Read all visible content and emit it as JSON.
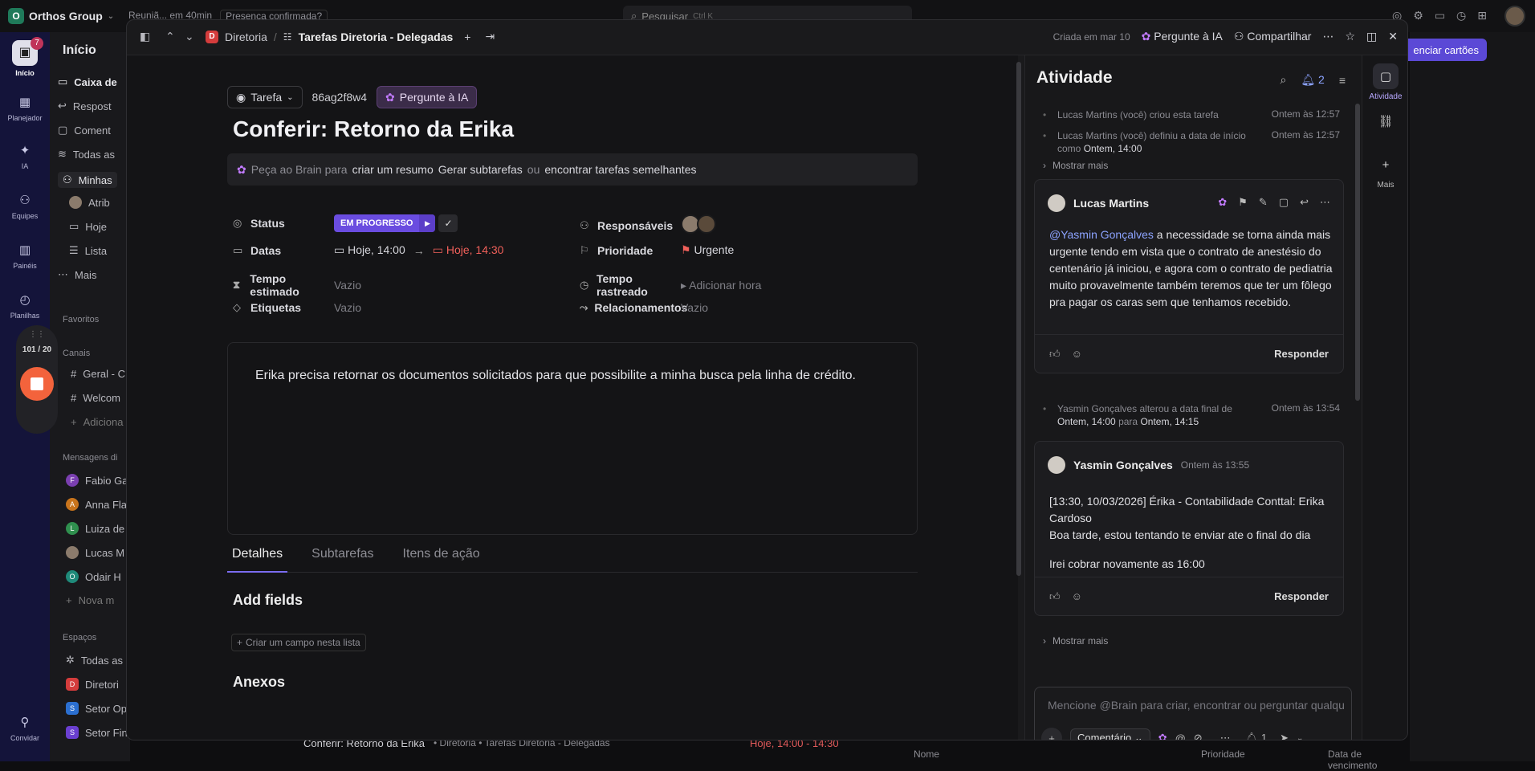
{
  "topbar": {
    "workspace": "Orthos Group",
    "workspace_initial": "O",
    "meeting_text": "Reuniã... em 40min",
    "meeting_status": "Presença confirmada?",
    "search_placeholder": "Pesquisar",
    "search_shortcut": "Ctrl K"
  },
  "rail": {
    "items": [
      {
        "label": "Início",
        "icon": "inbox-icon"
      },
      {
        "label": "Planejador",
        "icon": "calendar-icon"
      },
      {
        "label": "IA",
        "icon": "ai-icon"
      },
      {
        "label": "Equipes",
        "icon": "teams-icon"
      },
      {
        "label": "Painéis",
        "icon": "dashboard-icon"
      },
      {
        "label": "Planilhas",
        "icon": "timesheet-icon"
      },
      {
        "label": "Convidar",
        "icon": "invite-icon"
      }
    ],
    "badge": "7"
  },
  "recording": {
    "counter": "101 / 20"
  },
  "sidebar": {
    "title": "Início",
    "items": [
      "Caixa de",
      "Respost",
      "Coment",
      "Todas as",
      "Minhas",
      "Atrib",
      "Hoje",
      "Lista",
      "Mais"
    ],
    "favorites_label": "Favoritos",
    "channels_label": "Canais",
    "channels": [
      "Geral - C",
      "Welcom",
      "Adiciona"
    ],
    "dm_label": "Mensagens di",
    "dms": [
      {
        "initial": "F",
        "name": "Fabio Ga",
        "color": "#7a3fb0"
      },
      {
        "initial": "A",
        "name": "Anna Fla",
        "color": "#c8741c"
      },
      {
        "initial": "L",
        "name": "Luiza de",
        "color": "#2f8f4e"
      },
      {
        "initial": "",
        "name": "Lucas M",
        "color": "#8b7b6c"
      },
      {
        "initial": "O",
        "name": "Odair H",
        "color": "#1f8a7a"
      }
    ],
    "new_message": "Nova m",
    "spaces_label": "Espaços",
    "spaces": [
      {
        "initial": "",
        "name": "Todas as",
        "color": "#333"
      },
      {
        "initial": "D",
        "name": "Diretori",
        "color": "#d43c3c"
      },
      {
        "initial": "S",
        "name": "Setor Op",
        "color": "#2b6fd0"
      },
      {
        "initial": "S",
        "name": "Setor Fin",
        "color": "#6a3fd0"
      }
    ]
  },
  "background": {
    "button": "enciar cartões",
    "bottom_task": "Conferir: Retorno da Erika",
    "bottom_path": "• Diretoria • Tarefas Diretoria - Delegadas",
    "bottom_date": "Hoje, 14:00 - 14:30",
    "col_name": "Nome",
    "col_priority": "Prioridade",
    "col_due": "Data de vencimento"
  },
  "modal": {
    "breadcrumb_space": "Diretoria",
    "breadcrumb_list": "Tarefas Diretoria - Delegadas",
    "created": "Criada em mar 10",
    "ask_ai": "Pergunte à IA",
    "share": "Compartilhar",
    "task_type": "Tarefa",
    "task_id": "86ag2f8w4",
    "title": "Conferir: Retorno da Erika",
    "brain": {
      "prefix": "Peça ao Brain para",
      "opt1": "criar um resumo",
      "opt2": "Gerar subtarefas",
      "or": "ou",
      "opt3": "encontrar tarefas semelhantes"
    },
    "props": {
      "status_label": "Status",
      "status_value": "EM PROGRESSO",
      "dates_label": "Datas",
      "date_start": "Hoje, 14:00",
      "date_end": "Hoje, 14:30",
      "estimate_label": "Tempo estimado",
      "estimate_value": "Vazio",
      "tags_label": "Etiquetas",
      "tags_value": "Vazio",
      "assignees_label": "Responsáveis",
      "priority_label": "Prioridade",
      "priority_value": "Urgente",
      "tracked_label": "Tempo rastreado",
      "tracked_value": "Adicionar hora",
      "relations_label": "Relacionamentos",
      "relations_value": "Vazio"
    },
    "description": "Erika precisa retornar os documentos solicitados para que possibilite a minha busca pela linha de crédito.",
    "tabs": [
      "Detalhes",
      "Subtarefas",
      "Itens de ação"
    ],
    "add_fields": "Add fields",
    "create_field": "Criar um campo nesta lista",
    "attachments": "Anexos"
  },
  "activity": {
    "title": "Atividade",
    "notif_count": "2",
    "events": [
      {
        "text": "Lucas Martins (você) criou esta tarefa",
        "time": "Ontem às 12:57"
      },
      {
        "text": "Lucas Martins (você) definiu a data de início como",
        "bold": "Ontem, 14:00",
        "time": "Ontem às 12:57"
      }
    ],
    "show_more": "Mostrar mais",
    "comment1": {
      "author": "Lucas Martins",
      "mention": "@Yasmin Gonçalves",
      "text": " a necessidade se torna ainda mais urgente tendo em vista que o contrato de anestésio do centenário já iniciou, e agora com o contrato de pediatria muito provavelmente também teremos que ter um fôlego pra pagar os caras sem que tenhamos recebido.",
      "reply": "Responder"
    },
    "event3": {
      "text": "Yasmin Gonçalves alterou a data final de",
      "bold1": "Ontem, 14:00",
      "mid": "para",
      "bold2": "Ontem, 14:15",
      "time": "Ontem às 13:54"
    },
    "comment2": {
      "author": "Yasmin Gonçalves",
      "time": "Ontem às 13:55",
      "line1": "[13:30, 10/03/2026] Érika - Contabilidade Conttal: Erika Cardoso",
      "line2": "Boa tarde, estou tentando te enviar ate o final do dia",
      "line3": "Irei cobrar novamente as 16:00",
      "reply": "Responder"
    },
    "composer_placeholder": "Mencione @Brain para criar, encontrar ou perguntar qualquer coisa",
    "composer_type": "Comentário",
    "watchers": "1"
  },
  "side": {
    "items": [
      {
        "label": "Atividade",
        "icon": "chat-icon"
      },
      {
        "label": "",
        "icon": "link-icon"
      },
      {
        "label": "Mais",
        "icon": "plus-icon"
      }
    ]
  }
}
